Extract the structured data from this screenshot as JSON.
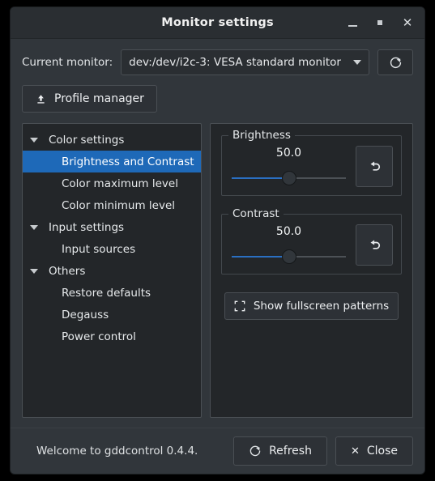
{
  "window": {
    "title": "Monitor settings",
    "controls": {
      "minimize": "minimize",
      "maximize": "maximize",
      "close": "close"
    }
  },
  "monitor": {
    "label": "Current monitor:",
    "selected": "dev:/dev/i2c-3: VESA standard monitor",
    "options": [
      "dev:/dev/i2c-3: VESA standard monitor"
    ],
    "refresh_icon": "refresh-icon"
  },
  "profile": {
    "label": "Profile manager",
    "icon": "upload-icon"
  },
  "tree": {
    "items": [
      {
        "label": "Color settings",
        "level": "parent",
        "expanded": true,
        "selected": false
      },
      {
        "label": "Brightness and Contrast",
        "level": "child",
        "expanded": false,
        "selected": true
      },
      {
        "label": "Color maximum level",
        "level": "child",
        "expanded": false,
        "selected": false
      },
      {
        "label": "Color minimum level",
        "level": "child",
        "expanded": false,
        "selected": false
      },
      {
        "label": "Input settings",
        "level": "parent",
        "expanded": true,
        "selected": false
      },
      {
        "label": "Input sources",
        "level": "child",
        "expanded": false,
        "selected": false
      },
      {
        "label": "Others",
        "level": "parent",
        "expanded": true,
        "selected": false
      },
      {
        "label": "Restore defaults",
        "level": "child",
        "expanded": false,
        "selected": false
      },
      {
        "label": "Degauss",
        "level": "child",
        "expanded": false,
        "selected": false
      },
      {
        "label": "Power control",
        "level": "child",
        "expanded": false,
        "selected": false
      }
    ]
  },
  "controls": {
    "brightness": {
      "title": "Brightness",
      "value": "50.0",
      "percent": 50,
      "reset_icon": "undo-icon"
    },
    "contrast": {
      "title": "Contrast",
      "value": "50.0",
      "percent": 50,
      "reset_icon": "undo-icon"
    },
    "patterns": {
      "label": "Show fullscreen patterns",
      "icon": "fullscreen-icon"
    }
  },
  "footer": {
    "status": "Welcome to gddcontrol 0.4.4.",
    "refresh_label": "Refresh",
    "close_label": "Close"
  },
  "colors": {
    "window_bg": "#31363b",
    "panel_bg": "#232629",
    "titlebar_bg": "#2a2e32",
    "accent": "#1e69b8",
    "slider_fill": "#2a6fc2",
    "text": "#e6e9eb",
    "border": "#4a4f54"
  }
}
